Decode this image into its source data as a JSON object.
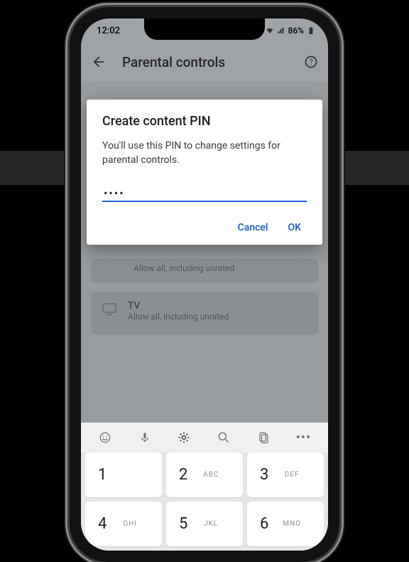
{
  "status": {
    "time": "12:02",
    "battery": "86%"
  },
  "appbar": {
    "title": "Parental controls"
  },
  "list": {
    "apps_sub": "Allow all, including unrated",
    "tv_label": "TV",
    "tv_sub": "Allow all, including unrated"
  },
  "dialog": {
    "title": "Create content PIN",
    "body": "You'll use this PIN to change settings for parental controls.",
    "pin_masked": "••••",
    "cancel": "Cancel",
    "ok": "OK"
  },
  "keys": {
    "k1": {
      "d": "1",
      "l": ""
    },
    "k2": {
      "d": "2",
      "l": "ABC"
    },
    "k3": {
      "d": "3",
      "l": "DEF"
    },
    "k4": {
      "d": "4",
      "l": "GHI"
    },
    "k5": {
      "d": "5",
      "l": "JKL"
    },
    "k6": {
      "d": "6",
      "l": "MNO"
    }
  }
}
